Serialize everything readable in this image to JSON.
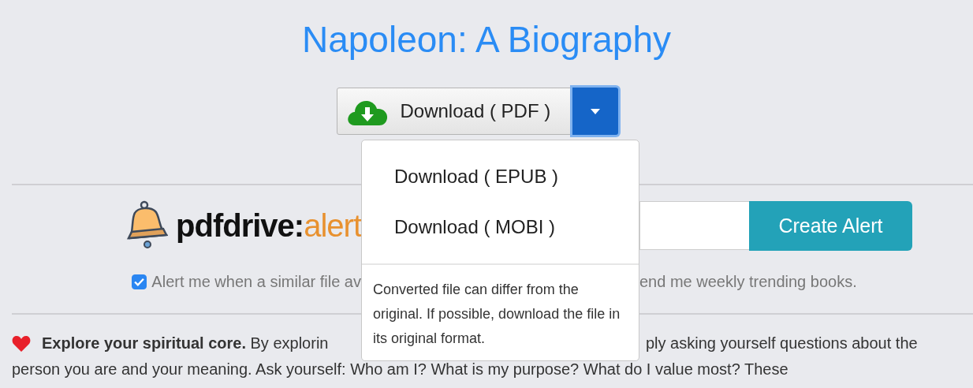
{
  "title": "Napoleon: A Biography",
  "download": {
    "label": "Download ( PDF )",
    "menu_open": true
  },
  "menu": {
    "items": [
      "Download ( EPUB )",
      "Download ( MOBI )"
    ],
    "note": "Converted file can differ from the original. If possible, download the file in its original format."
  },
  "alerts": {
    "logo_name": "pdfdrive:",
    "logo_suffix": "alert",
    "button": "Create Alert",
    "checkbox": {
      "checked": true,
      "label_left": "Alert me when a similar file av",
      "label_right": "end me weekly trending books."
    }
  },
  "article": {
    "line1_left": "**Explore your spiritual core.** By explorin",
    "line1_right": "ply asking yourself questions about the",
    "line2": "person you are and your meaning. Ask yourself: Who am I? What is my purpose? What do I value most? These"
  }
}
